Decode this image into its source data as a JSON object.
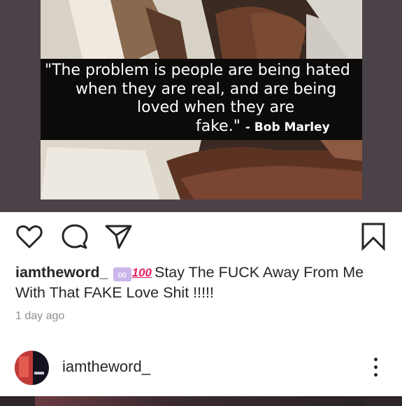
{
  "post1": {
    "quote": {
      "line1": "\"The problem is people are being hated",
      "line2": "when they are real, and are being",
      "line3": "loved when they are",
      "line4": "fake.\" ",
      "author": "- Bob Marley"
    },
    "actions": {
      "like": "heart-icon",
      "comment": "comment-icon",
      "share": "share-icon",
      "save": "bookmark-icon"
    },
    "caption": {
      "username": "iamtheword_",
      "emoji_infinity": "∞",
      "emoji_hundred": "100",
      "text_line1": "Stay The FUCK Away From Me",
      "text_line2": "With That FAKE Love Shit !!!!!"
    },
    "timestamp": "1 day ago"
  },
  "post2": {
    "username": "iamtheword_",
    "more": "more-options-icon"
  },
  "colors": {
    "frame": "#4b4148",
    "text": "#262626",
    "muted": "#8e8e8e",
    "hundred_red": "#e0245e",
    "infinity_bg": "#cbb6ea"
  }
}
